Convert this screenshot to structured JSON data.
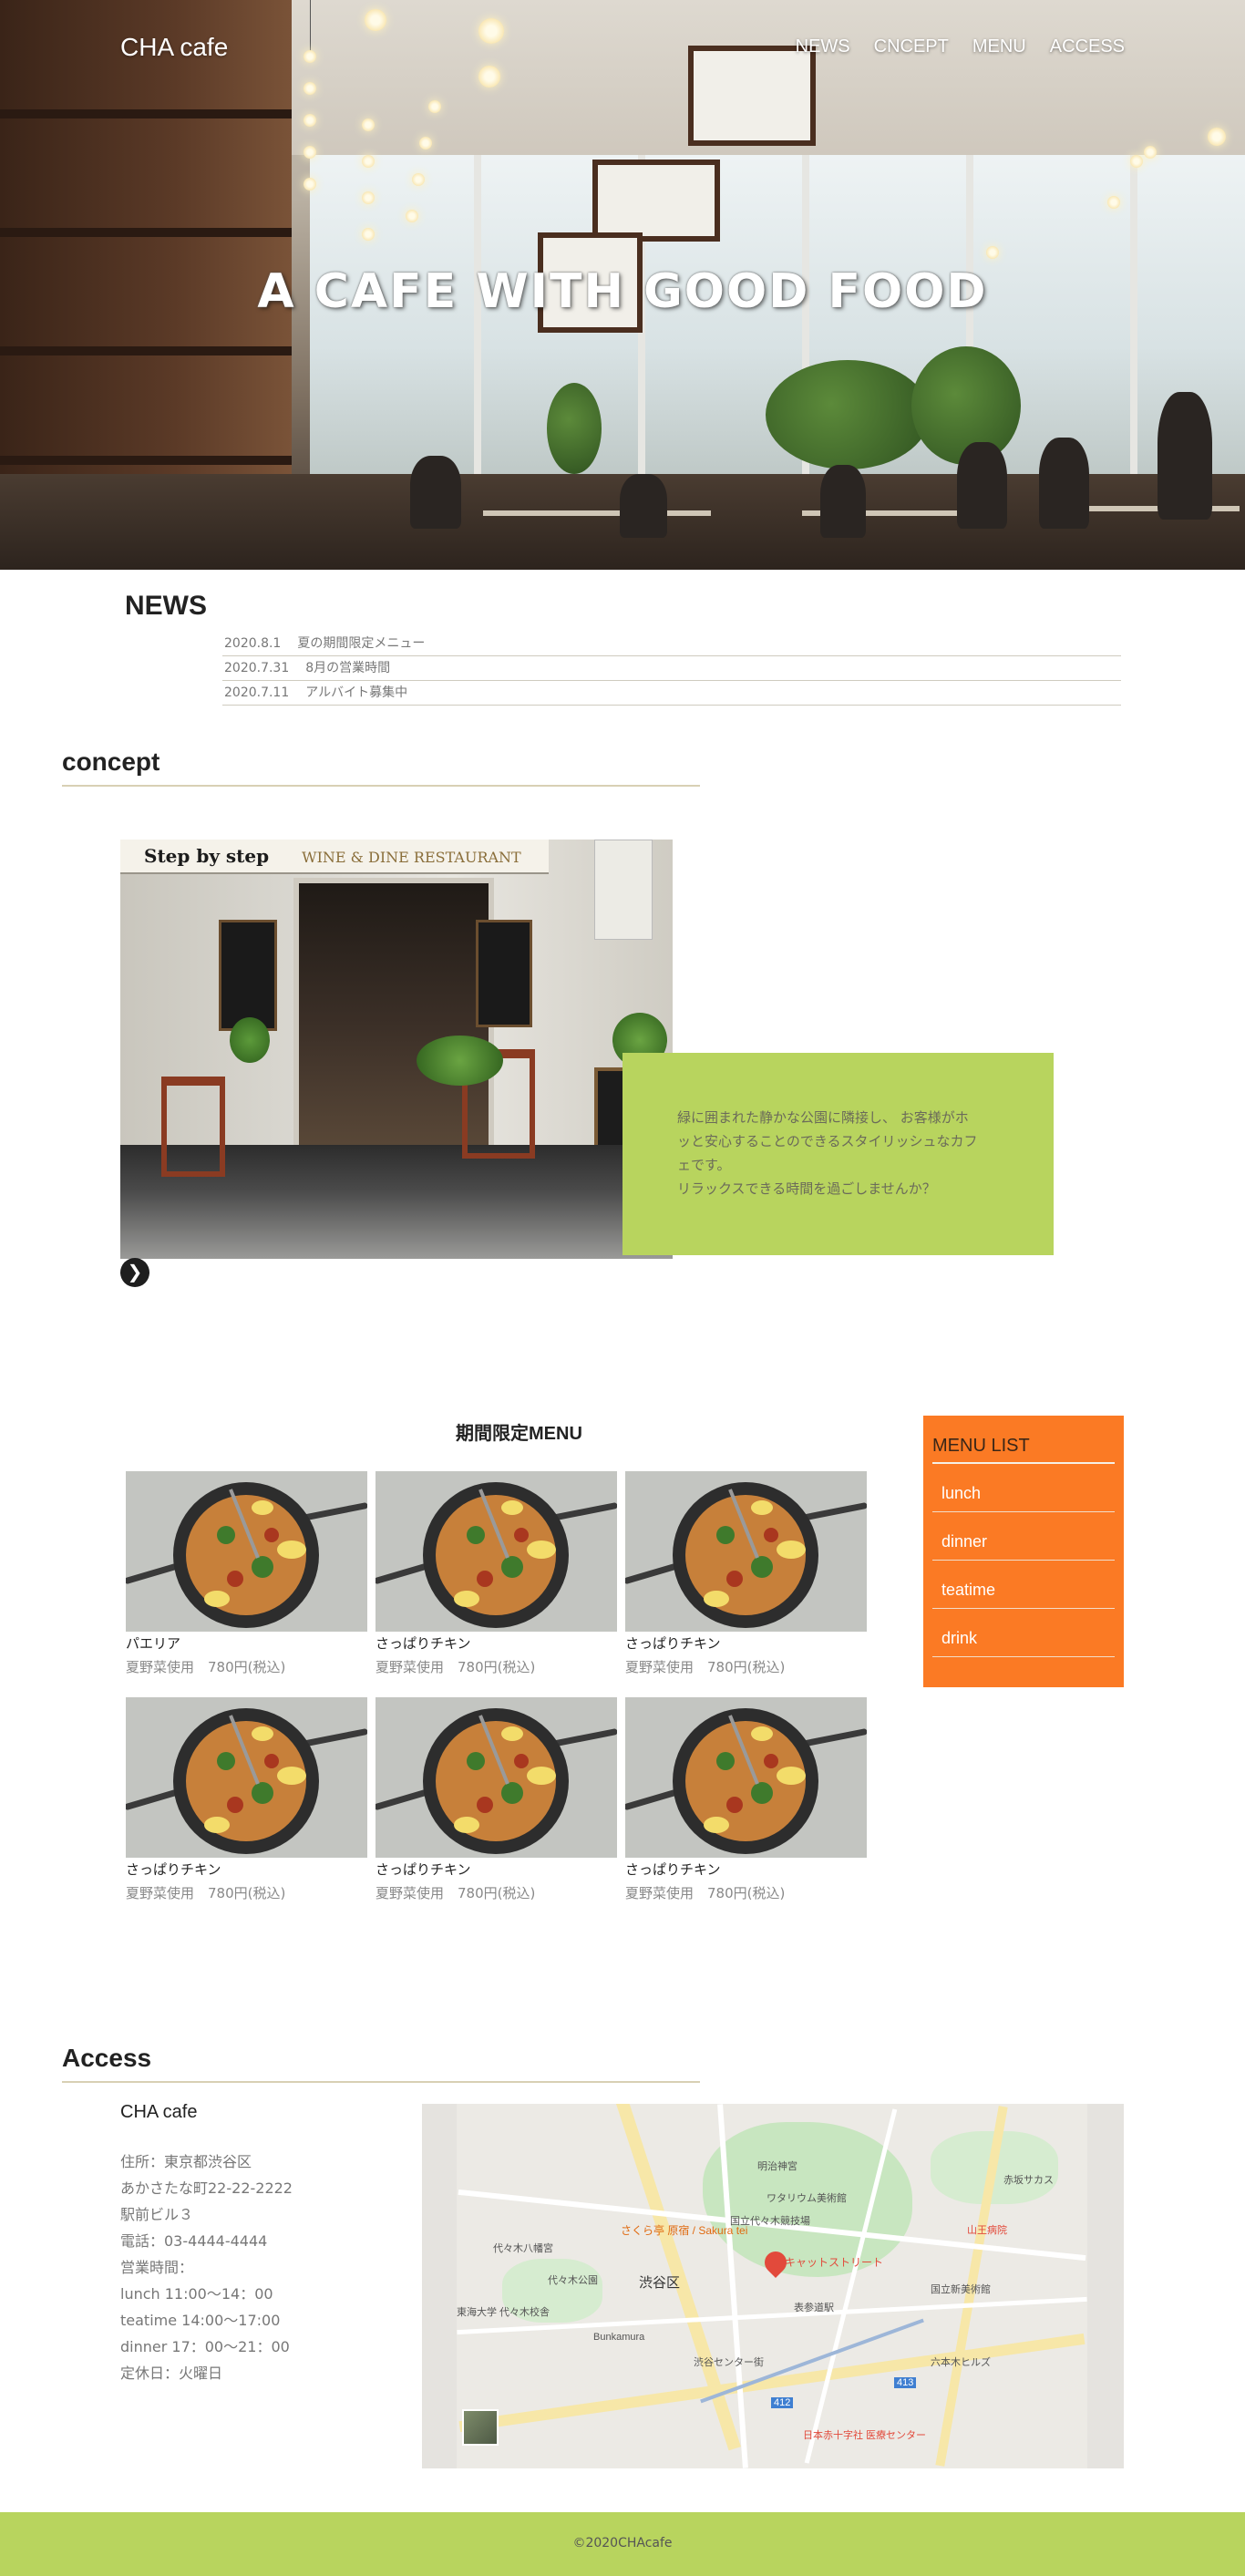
{
  "header": {
    "brand": "CHA cafe",
    "nav": [
      "NEWS",
      "CNCEPT",
      "MENU",
      "ACCESS"
    ],
    "hero_title": "A CAFE WITH GOOD FOOD"
  },
  "news": {
    "heading": "NEWS",
    "items": [
      {
        "date": "2020.8.1",
        "text": "夏の期間限定メニュー"
      },
      {
        "date": "2020.7.31",
        "text": "8月の営業時間"
      },
      {
        "date": "2020.7.11",
        "text": "アルバイト募集中"
      }
    ]
  },
  "concept": {
    "heading": "concept",
    "photo_sign": "Step by step",
    "photo_sign2": "WINE & DINE RESTAURANT",
    "text": [
      "緑に囲まれた静かな公園に隣接し、 お客様がホ",
      "ッと安心することのできるスタイリッシュなカフ",
      "ェです。",
      "リラックスできる時間を過ごしませんか？"
    ],
    "arrow_icon": "circle-arrow-right-icon"
  },
  "menu": {
    "title": "期間限定MENU",
    "items": [
      {
        "name": "パエリア",
        "desc": "夏野菜使用　780円(税込)"
      },
      {
        "name": "さっぱりチキン",
        "desc": "夏野菜使用　780円(税込)"
      },
      {
        "name": "さっぱりチキン",
        "desc": "夏野菜使用　780円(税込)"
      },
      {
        "name": "さっぱりチキン",
        "desc": "夏野菜使用　780円(税込)"
      },
      {
        "name": "さっぱりチキン",
        "desc": "夏野菜使用　780円(税込)"
      },
      {
        "name": "さっぱりチキン",
        "desc": "夏野菜使用　780円(税込)"
      }
    ]
  },
  "menu_list": {
    "title": "MENU LIST",
    "items": [
      "lunch",
      "dinner",
      "teatime",
      "drink"
    ],
    "color": "#fb7a24"
  },
  "access": {
    "heading": "Access",
    "shop": "CHA cafe",
    "lines": [
      "住所：東京都渋谷区",
      "あかさたな町22-22-2222",
      "駅前ビル３",
      "電話：03-4444-4444",
      "営業時間：",
      "lunch 11:00～14：00",
      "teatime 14:00～17:00",
      "dinner 17：00～21：00",
      "定休日：火曜日"
    ],
    "map_labels": [
      "代々木八幡宮",
      "代々木公園",
      "明治神宮",
      "国立代々木競技場",
      "渋谷区",
      "さくら亭 原宿 / Sakura tei",
      "キャットストリート",
      "表参道駅",
      "Bunkamura",
      "渋谷センター街",
      "東海大学 代々木校舎",
      "六本木ヒルズ",
      "日本赤十字社 医療センター",
      "山王病院",
      "国立新美術館",
      "ワタリウム美術館",
      "赤坂サカス",
      "412",
      "413"
    ]
  },
  "footer": {
    "copyright": "©2020CHAcafe",
    "color": "#b8d45e"
  }
}
